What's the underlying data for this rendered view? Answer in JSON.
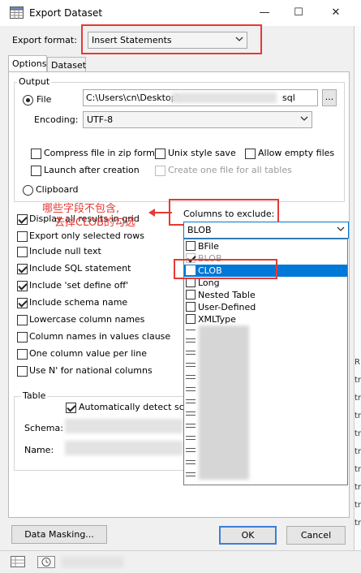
{
  "window": {
    "title": "Export Dataset"
  },
  "format": {
    "label": "Export format:",
    "value": "Insert Statements"
  },
  "tabs": [
    {
      "label": "Options"
    },
    {
      "label": "Dataset"
    }
  ],
  "output": {
    "group_label": "Output",
    "file_label": "File",
    "file_path": "C:\\Users\\cn\\Desktop\\",
    "file_ext": "sql",
    "browse_label": "...",
    "encoding_label": "Encoding:",
    "encoding_value": "UTF-8",
    "compress_label": "Compress file in zip format",
    "unix_label": "Unix style save",
    "allow_empty_label": "Allow empty files",
    "launch_label": "Launch after creation",
    "one_file_label": "Create one file for all tables",
    "clipboard_label": "Clipboard"
  },
  "options": [
    {
      "label": "Display all results in grid",
      "checked": true
    },
    {
      "label": "Export only selected rows",
      "checked": false
    },
    {
      "label": "Include null text",
      "checked": false
    },
    {
      "label": "Include SQL statement",
      "checked": true
    },
    {
      "label": "Include 'set define off'",
      "checked": true
    },
    {
      "label": "Include schema name",
      "checked": true
    },
    {
      "label": "Lowercase column names",
      "checked": false
    },
    {
      "label": "Column names in values clause",
      "checked": false
    },
    {
      "label": "One column value per line",
      "checked": false
    },
    {
      "label": "Use N' for national columns",
      "checked": false
    }
  ],
  "exclude": {
    "label": "Columns to exclude:",
    "value": "BLOB",
    "items": [
      {
        "label": "BFile",
        "checked": false,
        "highlighted": false
      },
      {
        "label": "BLOB",
        "checked": true,
        "highlighted": false
      },
      {
        "label": "CLOB",
        "checked": false,
        "highlighted": true
      },
      {
        "label": "Long",
        "checked": false,
        "highlighted": false
      },
      {
        "label": "Nested Table",
        "checked": false,
        "highlighted": false
      },
      {
        "label": "User-Defined",
        "checked": false,
        "highlighted": false
      },
      {
        "label": "XMLType",
        "checked": false,
        "highlighted": false
      }
    ]
  },
  "table": {
    "group_label": "Table",
    "auto_detect_label": "Automatically detect schem",
    "schema_label": "Schema:",
    "name_label": "Name:"
  },
  "annotation": {
    "line1": "哪些字段不包含,",
    "line2": "去掉CLOB的勾选"
  },
  "buttons": {
    "masking": "Data Masking...",
    "ok": "OK",
    "cancel": "Cancel"
  },
  "window_controls": {
    "minimize": "—",
    "maximize": "☐",
    "close": "✕"
  },
  "background_chars": [
    "R",
    "tr",
    "tr",
    "tr",
    "tr",
    "tr",
    "tr",
    "tr",
    "tr",
    "tr"
  ],
  "colors": {
    "annotation_red": "#e53935",
    "highlight_blue": "#0078d7"
  }
}
